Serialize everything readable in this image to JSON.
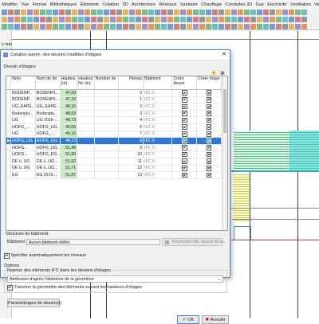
{
  "menubar": [
    "Modifier",
    "Vue",
    "Format",
    "Bibliothèques",
    "Eléments",
    "Cotation",
    "3D",
    "Architecture",
    "Réseaux",
    "Sanitaire",
    "Chauffage",
    "Conduites 3D",
    "Gaz",
    "Electricité",
    "Ventilation",
    "Ventil"
  ],
  "left_panel": {
    "title": "s import IFC"
  },
  "colors": {
    "accent": "#2f78d6",
    "height_cell": "#c8ebc5"
  },
  "dialog": {
    "title": "Création autom. des dessins modèles d'étages",
    "section_label": "Dessin d'étages",
    "columns": [
      "Nom",
      "Nom de de",
      "Hauteur (m)",
      "Hauteur Nc (m)",
      "Nombre de",
      "Niveau",
      "Bâtiment",
      "Créer dessir",
      "Créer étage"
    ],
    "rows": [
      {
        "nom": "BODENP...",
        "nomde": "BODENPL...",
        "hauteur": "47,09",
        "niveau": "0",
        "bat": "IFC 0"
      },
      {
        "nom": "BODENP...",
        "nomde": "BODENPL...",
        "hauteur": "47,19",
        "niveau": "1",
        "bat": "IFC 0"
      },
      {
        "nom": "UG_KAPE...",
        "nomde": "UG_KAPE...",
        "hauteur": "48,10",
        "niveau": "2",
        "bat": "IFC 0"
      },
      {
        "nom": "Bodenpla...",
        "nomde": "Bodenpla...",
        "hauteur": "48,63",
        "niveau": "3",
        "bat": "IFC 0"
      },
      {
        "nom": "UG",
        "nomde": "UG 2016-...",
        "hauteur": "48,73",
        "niveau": "4",
        "bat": "IFC 0"
      },
      {
        "nom": "HOFG_...",
        "nomde": "HOFG_UG...",
        "hauteur": "49,06",
        "niveau": "6",
        "bat": "IFC 0"
      },
      {
        "nom": "UG",
        "nomde": "HOFG_...",
        "hauteur": "49,16",
        "niveau": "7",
        "bat": "IFC 0"
      },
      {
        "nom": "HOFG_UG...",
        "nomde": "HOFG_UG...",
        "hauteur": "49,23",
        "niveau": "8",
        "bat": "IFC 0",
        "selected": true
      },
      {
        "nom": "HOFG...",
        "nomde": "HOFG_UG...",
        "hauteur": "51,46",
        "niveau": "9",
        "bat": "IFC 0"
      },
      {
        "nom": "HOFG...",
        "nomde": "HOFG_EG...",
        "hauteur": "51,50",
        "niveau": "10",
        "bat": "IFC 0"
      },
      {
        "nom": "DE ü. UG",
        "nomde": "DE ü. UG...",
        "hauteur": "51,62",
        "niveau": "11",
        "bat": "IFC 0"
      },
      {
        "nom": "DE ü. UG",
        "nomde": "DE ü. UG...",
        "hauteur": "51,71",
        "niveau": "12",
        "bat": "IFC 0"
      },
      {
        "nom": "EG",
        "nomde": "EG 2016-...",
        "hauteur": "51,87",
        "niveau": "13",
        "bat": "IFC 0"
      }
    ],
    "building_section": "Structure de bâtiment",
    "building_label": "Bâtiment",
    "building_value": "Aucun bâtiment défini",
    "reprise_button": "Reprendre bât. depuis Nova",
    "auto_levels": "Spécifier automatiquement les niveaux",
    "options_label": "Options",
    "reprise_label": "Reprise des éléments IFC dans les dessins d'étages",
    "attribution_value": "Attribution d'après l'altimétrie de la géométrie",
    "trancher": "Trancher la géométrie des éléments suivant les hauteurs d'étages",
    "params_button": "Paramétrages de dessin(s)",
    "ok": "OK",
    "cancel": "Annuler"
  }
}
